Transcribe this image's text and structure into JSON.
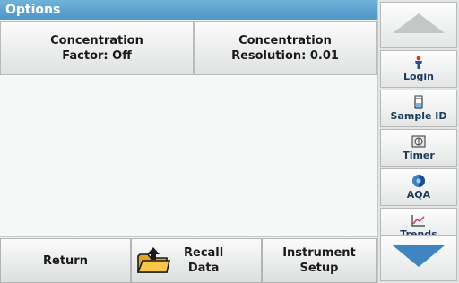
{
  "title": "Options",
  "options": [
    {
      "line1": "Concentration",
      "line2": "Factor: Off"
    },
    {
      "line1": "Concentration",
      "line2": "Resolution: 0.01"
    }
  ],
  "bottom": {
    "return_label": "Return",
    "recall_line1": "Recall",
    "recall_line2": "Data",
    "setup_line1": "Instrument",
    "setup_line2": "Setup"
  },
  "sidebar": {
    "items": [
      {
        "label": "Login",
        "icon": "login-icon"
      },
      {
        "label": "Sample ID",
        "icon": "sample-id-icon"
      },
      {
        "label": "Timer",
        "icon": "timer-icon"
      },
      {
        "label": "AQA",
        "icon": "aqa-icon"
      },
      {
        "label": "Trends",
        "icon": "trends-icon"
      }
    ]
  },
  "colors": {
    "title_bar": "#5aa2d0",
    "arrow": "#3f86c0",
    "arrow_up": "#c3c5c5"
  }
}
